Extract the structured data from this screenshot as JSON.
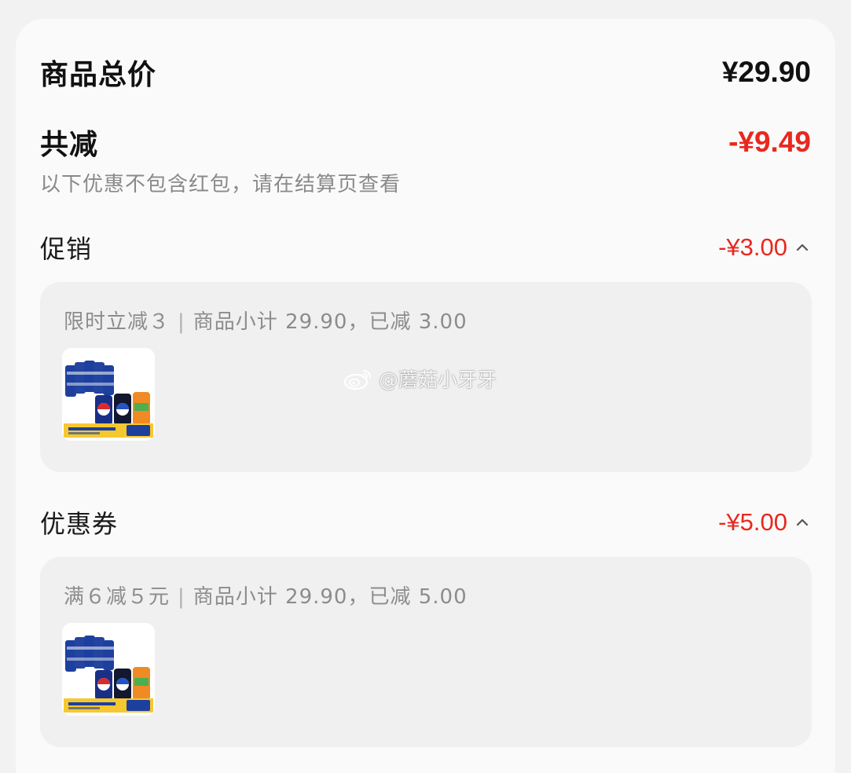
{
  "summary": {
    "total_label": "商品总价",
    "total_value": "¥29.90",
    "discount_label": "共减",
    "discount_value": "-¥9.49",
    "note": "以下优惠不包含红包，请在结算页查看"
  },
  "sections": [
    {
      "title": "促销",
      "amount": "-¥3.00",
      "detail_name": "限时立减３",
      "separator": "|",
      "detail_info": "商品小计 29.90，已减 3.00",
      "product_image": "cola-multipack-icon"
    },
    {
      "title": "优惠券",
      "amount": "-¥5.00",
      "detail_name": "满６减５元",
      "separator": "|",
      "detail_info": "商品小计 29.90，已减 5.00",
      "product_image": "cola-multipack-icon"
    }
  ],
  "watermark": {
    "text": "@蘑菇小牙牙",
    "icon": "weibo-icon"
  },
  "colors": {
    "accent_red": "#e8281e",
    "text_dark": "#111111",
    "text_muted": "#8c8c8c",
    "card_bg": "#fafafa",
    "panel_bg": "#f0f0f0"
  }
}
